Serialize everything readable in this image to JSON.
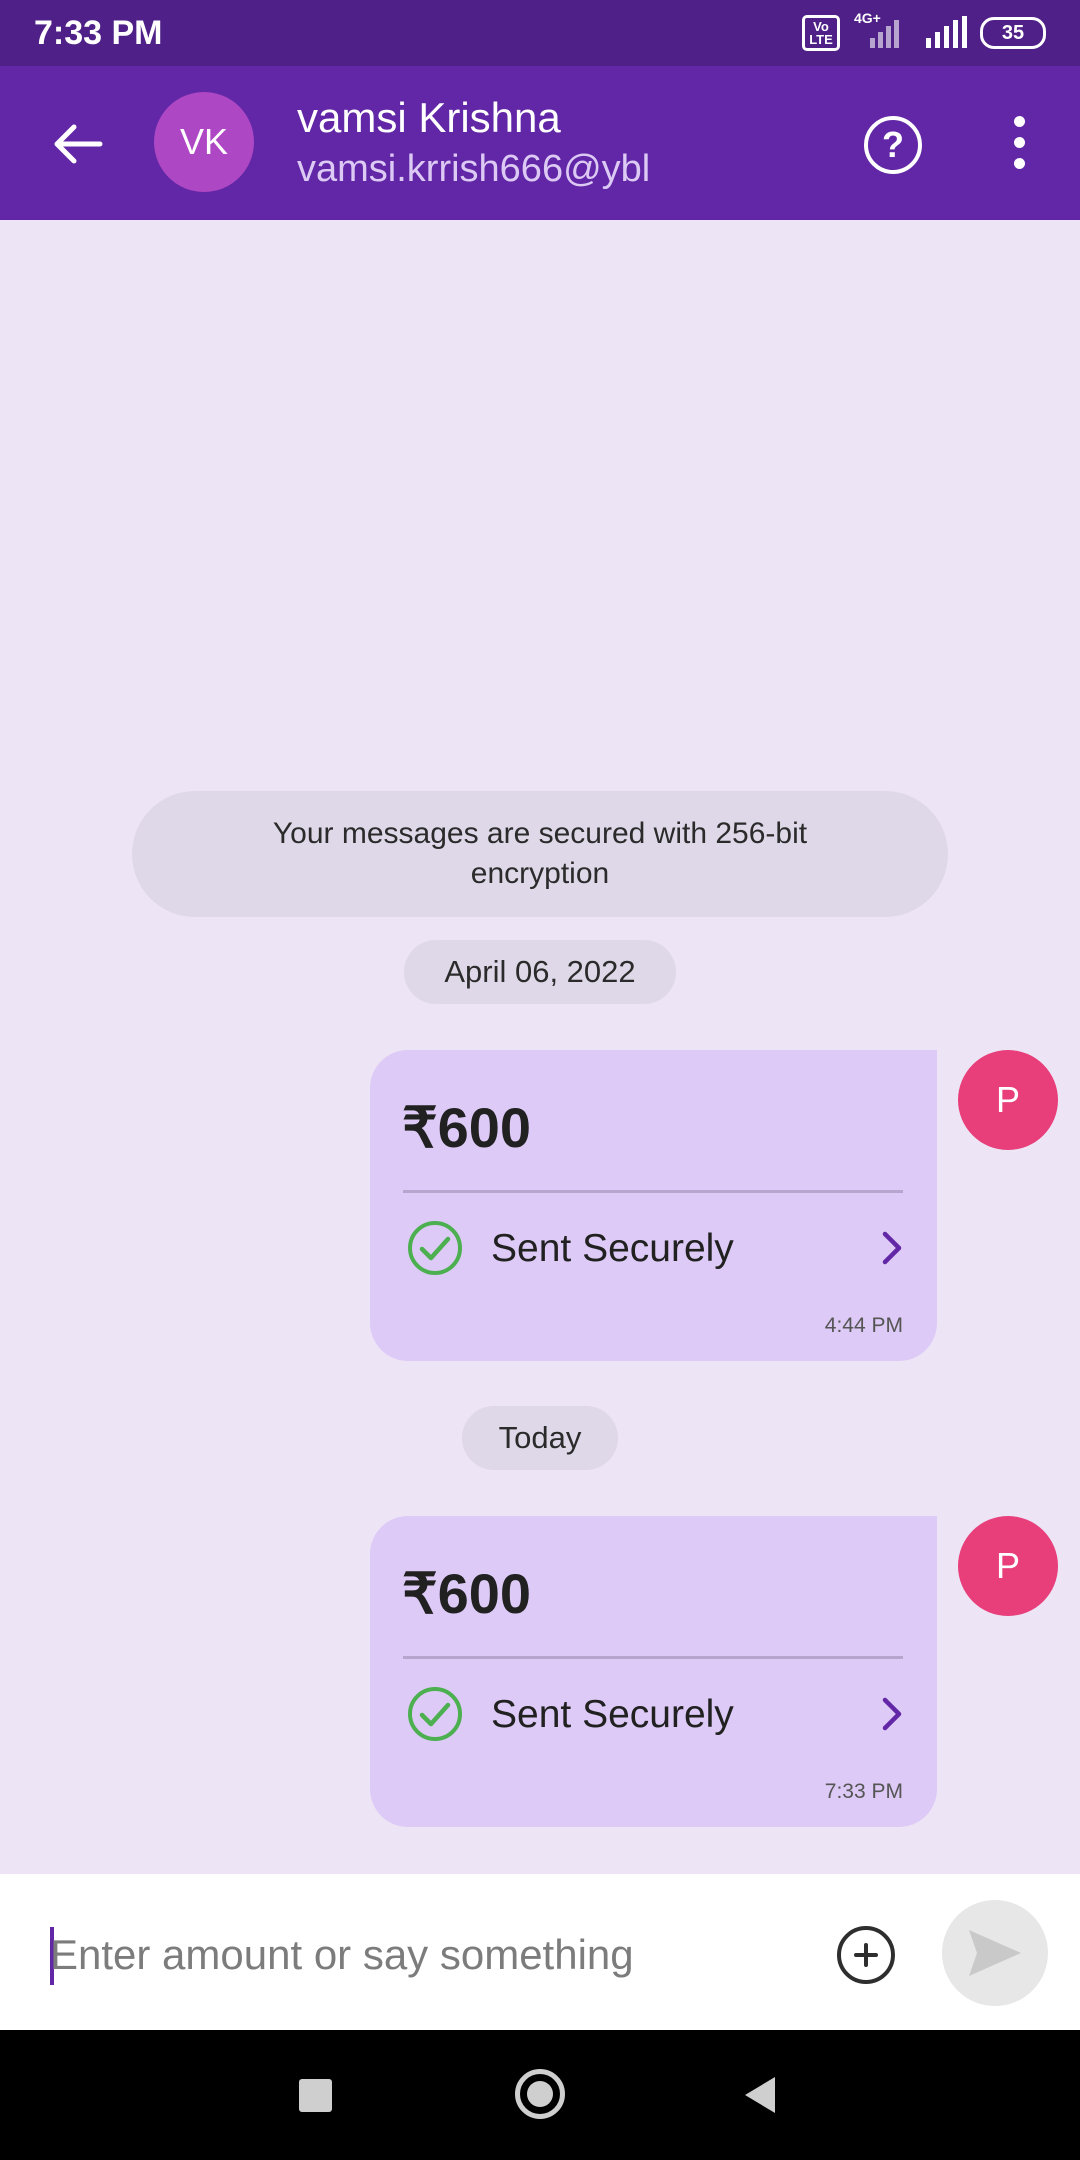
{
  "status_bar": {
    "time": "7:33 PM",
    "volte_label": "Vo\nLTE",
    "network_type": "4G+",
    "battery_level": "35"
  },
  "header": {
    "avatar_initials": "VK",
    "contact_name": "vamsi Krishna",
    "contact_upi": "vamsi.krrish666@ybl",
    "help_icon": "question-circle-icon",
    "menu_icon": "more-vertical-icon"
  },
  "chat": {
    "security_notice": "Your messages are secured with 256-bit encryption",
    "transactions": [
      {
        "date_label": "April 06, 2022",
        "amount": "₹600",
        "status": "Sent Securely",
        "time": "4:44 PM",
        "payer_initial": "P"
      },
      {
        "date_label": "Today",
        "amount": "₹600",
        "status": "Sent Securely",
        "time": "7:33 PM",
        "payer_initial": "P"
      }
    ]
  },
  "composer": {
    "placeholder": "Enter amount or say something",
    "value": ""
  },
  "colors": {
    "header": "#6227A6",
    "status_bar": "#4F2088",
    "background": "#EDE5F6",
    "card": "#DDCAF6",
    "payer_avatar": "#E83E7A",
    "success": "#4CAF50"
  }
}
